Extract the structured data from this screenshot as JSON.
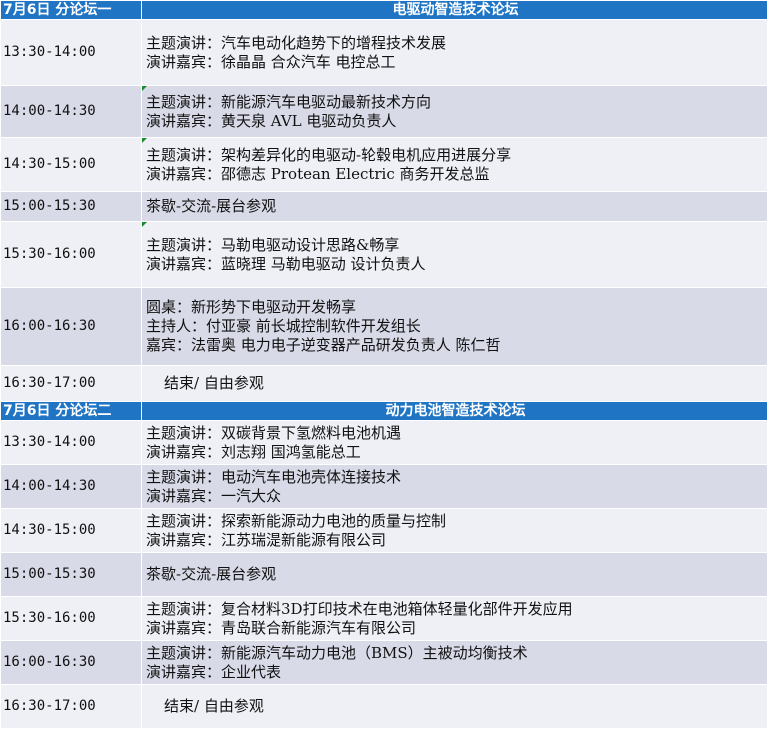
{
  "forums": [
    {
      "date_label": "7月6日 分论坛一",
      "title": "电驱动智造技术论坛",
      "sessions": [
        {
          "time": "13:30-14:00",
          "lines": [
            "主题演讲：汽车电动化趋势下的增程技术发展",
            "演讲嘉宾：徐晶晶 合众汽车 电控总工"
          ]
        },
        {
          "time": "14:00-14:30",
          "lines": [
            "主题演讲：新能源汽车电驱动最新技术方向",
            "演讲嘉宾：黄天泉 AVL 电驱动负责人"
          ]
        },
        {
          "time": "14:30-15:00",
          "lines": [
            "主题演讲：架构差异化的电驱动-轮毂电机应用进展分享",
            "演讲嘉宾：邵德志 Protean Electric 商务开发总监"
          ]
        },
        {
          "time": "15:00-15:30",
          "lines": [
            "茶歇-交流-展台参观"
          ]
        },
        {
          "time": "15:30-16:00",
          "lines": [
            "主题演讲：马勒电驱动设计思路&畅享",
            "演讲嘉宾：蓝晓理 马勒电驱动 设计负责人"
          ]
        },
        {
          "time": "16:00-16:30",
          "lines": [
            "圆桌：新形势下电驱动开发畅享",
            "主持人：付亚豪 前长城控制软件开发组长",
            "嘉宾：法雷奥 电力电子逆变器产品研发负责人 陈仁哲"
          ]
        },
        {
          "time": "16:30-17:00",
          "lines": [
            "结束/ 自由参观"
          ]
        }
      ]
    },
    {
      "date_label": "7月6日 分论坛二",
      "title": "动力电池智造技术论坛",
      "sessions": [
        {
          "time": "13:30-14:00",
          "lines": [
            "主题演讲：双碳背景下氢燃料电池机遇",
            "演讲嘉宾：刘志翔 国鸿氢能总工"
          ]
        },
        {
          "time": "14:00-14:30",
          "lines": [
            "主题演讲：电动汽车电池壳体连接技术",
            "演讲嘉宾：一汽大众"
          ]
        },
        {
          "time": "14:30-15:00",
          "lines": [
            "主题演讲：探索新能源动力电池的质量与控制",
            "演讲嘉宾：江苏瑞湜新能源有限公司"
          ]
        },
        {
          "time": "15:00-15:30",
          "lines": [
            "茶歇-交流-展台参观"
          ]
        },
        {
          "time": "15:30-16:00",
          "lines": [
            "主题演讲：复合材料3D打印技术在电池箱体轻量化部件开发应用",
            "演讲嘉宾：青岛联合新能源汽车有限公司"
          ]
        },
        {
          "time": "16:00-16:30",
          "lines": [
            "主题演讲：新能源汽车动力电池（BMS）主被动均衡技术",
            "演讲嘉宾：企业代表"
          ]
        },
        {
          "time": "16:30-17:00",
          "lines": [
            "结束/ 自由参观"
          ]
        }
      ]
    }
  ],
  "colors": {
    "band": "#1f74c3",
    "row_shade": "#d8dae8",
    "row_plain": "#eef0f6"
  }
}
